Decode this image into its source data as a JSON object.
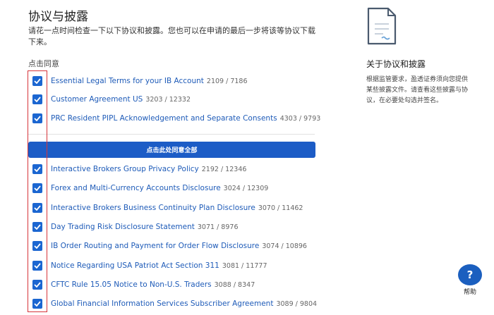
{
  "header": {
    "title": "协议与披露",
    "intro": "请花一点时间检查一下以下协议和披露。您也可以在申请的最后一步将该等协议下载下来。",
    "section_label": "点击同意"
  },
  "agreements_top": [
    {
      "label": "Essential Legal Terms for your IB Account",
      "code": "2109 / 7186"
    },
    {
      "label": "Customer Agreement US",
      "code": "3203 / 12332"
    },
    {
      "label": "PRC Resident PIPL Acknowledgement and Separate Consents",
      "code": "4303 / 9793"
    }
  ],
  "agree_all_label": "点击此处同意全部",
  "agreements_bottom": [
    {
      "label": "Interactive Brokers Group Privacy Policy",
      "code": "2192 / 12346"
    },
    {
      "label": "Forex and Multi-Currency Accounts Disclosure",
      "code": "3024 / 12309"
    },
    {
      "label": "Interactive Brokers Business Continuity Plan Disclosure",
      "code": "3070 / 11462"
    },
    {
      "label": "Day Trading Risk Disclosure Statement",
      "code": "3071 / 8976"
    },
    {
      "label": "IB Order Routing and Payment for Order Flow Disclosure",
      "code": "3074 / 10896"
    },
    {
      "label": "Notice Regarding USA Patriot Act Section 311",
      "code": "3081 / 11777"
    },
    {
      "label": "CFTC Rule 15.05 Notice to Non-U.S. Traders",
      "code": "3088 / 8347"
    },
    {
      "label": "Global Financial Information Services Subscriber Agreement",
      "code": "3089 / 9804"
    }
  ],
  "sidebar": {
    "icon": "document-icon",
    "title": "关于协议和披露",
    "text": "根据监管要求，盈透证券须向您提供某些披露文件。请查看这些披露与协议，在必要处勾选并签名。"
  },
  "help": {
    "icon": "question-bubble-icon",
    "label": "帮助"
  },
  "colors": {
    "primary": "#1c5cc6",
    "link": "#1e5bb8",
    "highlight": "#d6343a"
  }
}
